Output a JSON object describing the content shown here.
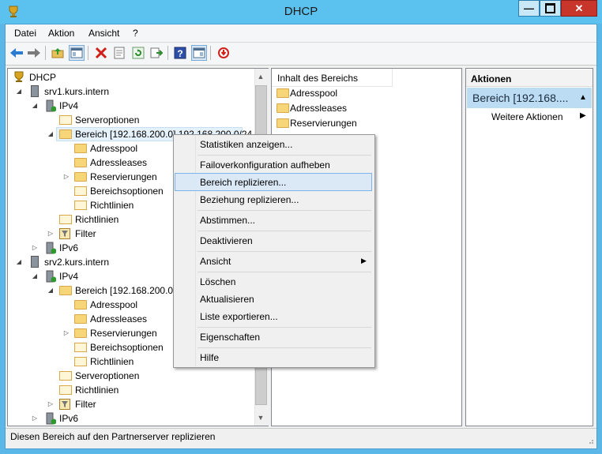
{
  "window": {
    "title": "DHCP"
  },
  "menu": [
    "Datei",
    "Aktion",
    "Ansicht",
    "?"
  ],
  "toolbar": [
    "back-icon",
    "forward-icon",
    "up-folder-icon",
    "console-tree-icon",
    "delete-icon",
    "properties-icon",
    "refresh-icon",
    "export-icon",
    "help-icon",
    "show-hide-icon",
    "deactivate-icon"
  ],
  "tree": {
    "root": "DHCP",
    "srv1": "srv1.kurs.intern",
    "srv1_ipv4": "IPv4",
    "srv1_serveroptionen": "Serveroptionen",
    "srv1_bereich": "Bereich [192.168.200.0] 192.168.200.0/24",
    "srv1_adresspool": "Adresspool",
    "srv1_adressleases": "Adressleases",
    "srv1_reservierungen": "Reservierungen",
    "srv1_bereichsoptionen": "Bereichsoptionen",
    "srv1_richtlinien_b": "Richtlinien",
    "srv1_richtlinien": "Richtlinien",
    "srv1_filter": "Filter",
    "srv1_ipv6": "IPv6",
    "srv2": "srv2.kurs.intern",
    "srv2_ipv4": "IPv4",
    "srv2_bereich": "Bereich [192.168.200.0]",
    "srv2_adresspool": "Adresspool",
    "srv2_adressleases": "Adressleases",
    "srv2_reservierungen": "Reservierungen",
    "srv2_bereichsoptionen": "Bereichsoptionen",
    "srv2_richtlinien_b": "Richtlinien",
    "srv2_serveroptionen": "Serveroptionen",
    "srv2_richtlinien": "Richtlinien",
    "srv2_filter": "Filter",
    "srv2_ipv6": "IPv6"
  },
  "content": {
    "header": "Inhalt des Bereichs",
    "items": [
      "Adresspool",
      "Adressleases",
      "Reservierungen"
    ]
  },
  "context_menu": {
    "statistiken": "Statistiken anzeigen...",
    "failover": "Failoverkonfiguration aufheben",
    "bereich_replizieren": "Bereich replizieren...",
    "beziehung_replizieren": "Beziehung replizieren...",
    "abstimmen": "Abstimmen...",
    "deaktivieren": "Deaktivieren",
    "ansicht": "Ansicht",
    "loeschen": "Löschen",
    "aktualisieren": "Aktualisieren",
    "liste_exportieren": "Liste exportieren...",
    "eigenschaften": "Eigenschaften",
    "hilfe": "Hilfe"
  },
  "actions": {
    "header": "Aktionen",
    "selected": "Bereich [192.168....",
    "more": "Weitere Aktionen"
  },
  "status": {
    "text": "Diesen Bereich auf den Partnerserver replizieren"
  }
}
